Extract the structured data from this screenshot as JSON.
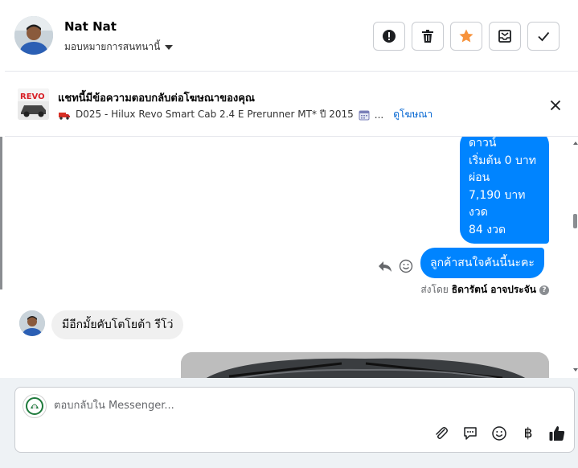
{
  "header": {
    "name": "Nat Nat",
    "assign_label": "มอบหมายการสนทนานี้",
    "actions": [
      "report-icon",
      "trash-icon",
      "star-icon",
      "mark-unread-icon",
      "check-icon"
    ],
    "star_color": "#f7923b"
  },
  "ad": {
    "title": "แชทนี้มีข้อความตอบกลับต่อโฆษณาของคุณ",
    "thumb_label": "REVO",
    "subtitle": "D025 - Hilux Revo Smart Cab 2.4 E Prerunner MT* ปี 2015",
    "ellipsis": "...",
    "link": "ดูโฆษณา"
  },
  "messages": {
    "outgoing_lines": [
      "ดาวน์",
      "เริ่มต้น 0 บาท",
      "ผ่อน",
      "7,190 บาท",
      "งวด",
      "84 งวด"
    ],
    "outgoing_pill": "ลูกค้าสนใจคันนี้นะคะ",
    "sent_by_prefix": "ส่งโดย",
    "sent_by_name": "ธิดารัตน์ อาจประจัน",
    "incoming": "มีอีกมั้ยคับโตโยต้า รีโว่"
  },
  "composer": {
    "placeholder": "ตอบกลับใน Messenger...",
    "baht_symbol": "฿"
  },
  "colors": {
    "accent": "#0084ff",
    "link": "#0064d1",
    "border": "#c9ccd1"
  }
}
